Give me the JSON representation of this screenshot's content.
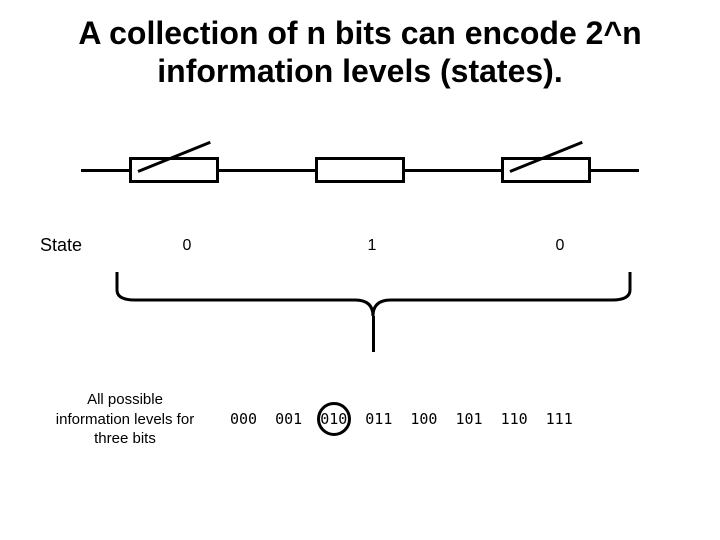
{
  "title": "A collection of n bits can encode 2^n information levels (states).",
  "state_label": "State",
  "switches": [
    {
      "state": "0",
      "open": true
    },
    {
      "state": "1",
      "open": false
    },
    {
      "state": "0",
      "open": true
    }
  ],
  "levels_label": "All possible information levels for three bits",
  "levels": [
    "000",
    "001",
    "010",
    "011",
    "100",
    "101",
    "110",
    "111"
  ],
  "highlight_index": 2
}
